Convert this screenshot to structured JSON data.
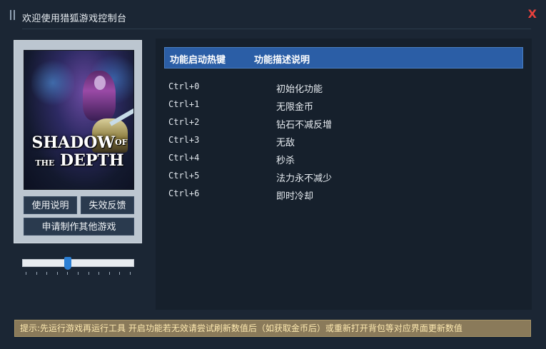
{
  "window": {
    "title": "欢迎使用猎狐游戏控制台",
    "close_label": "X"
  },
  "left": {
    "cover": {
      "logo_line1_main": "SHADOW",
      "logo_line1_small": "OF",
      "logo_line2_small": "THE",
      "logo_line2_main": "DEPTH"
    },
    "buttons": {
      "help": "使用说明",
      "feedback": "失效反馈",
      "request": "申请制作其他游戏"
    },
    "slider": {
      "value_fraction": 0.4
    }
  },
  "table": {
    "header": {
      "col1": "功能启动热键",
      "col2": "功能描述说明"
    },
    "rows": [
      {
        "key": "Ctrl+0",
        "desc": "初始化功能"
      },
      {
        "key": "Ctrl+1",
        "desc": "无限金币"
      },
      {
        "key": "Ctrl+2",
        "desc": "钻石不减反增"
      },
      {
        "key": "Ctrl+3",
        "desc": "无敌"
      },
      {
        "key": "Ctrl+4",
        "desc": "秒杀"
      },
      {
        "key": "Ctrl+5",
        "desc": "法力永不减少"
      },
      {
        "key": "Ctrl+6",
        "desc": "即时冷却"
      }
    ]
  },
  "footer": {
    "tip": "提示:先运行游戏再运行工具 开启功能若无效请尝试刷新数值后（如获取金币后）或重新打开背包等对应界面更新数值"
  },
  "colors": {
    "background": "#1b2634",
    "header_blue": "#2b5ea6",
    "close_red": "#e8413c",
    "slider_thumb": "#2b7fd4",
    "tip_bg": "#8a7a5a"
  }
}
